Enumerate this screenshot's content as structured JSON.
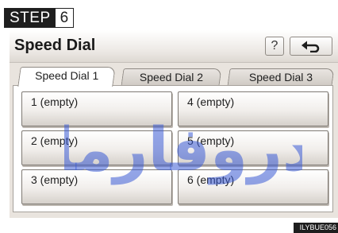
{
  "step": {
    "word": "STEP",
    "number": "6"
  },
  "header": {
    "title": "Speed Dial",
    "help_label": "?"
  },
  "tabs": [
    {
      "label": "Speed Dial 1",
      "active": true
    },
    {
      "label": "Speed Dial 2",
      "active": false
    },
    {
      "label": "Speed Dial 3",
      "active": false
    }
  ],
  "slots": [
    {
      "label": "1 (empty)"
    },
    {
      "label": "2 (empty)"
    },
    {
      "label": "3 (empty)"
    },
    {
      "label": "4 (empty)"
    },
    {
      "label": "5 (empty)"
    },
    {
      "label": "6 (empty)"
    }
  ],
  "watermark": {
    "text": "دروفارما",
    "color": "#3b5bd6"
  },
  "image_code": "ILYBUE056"
}
